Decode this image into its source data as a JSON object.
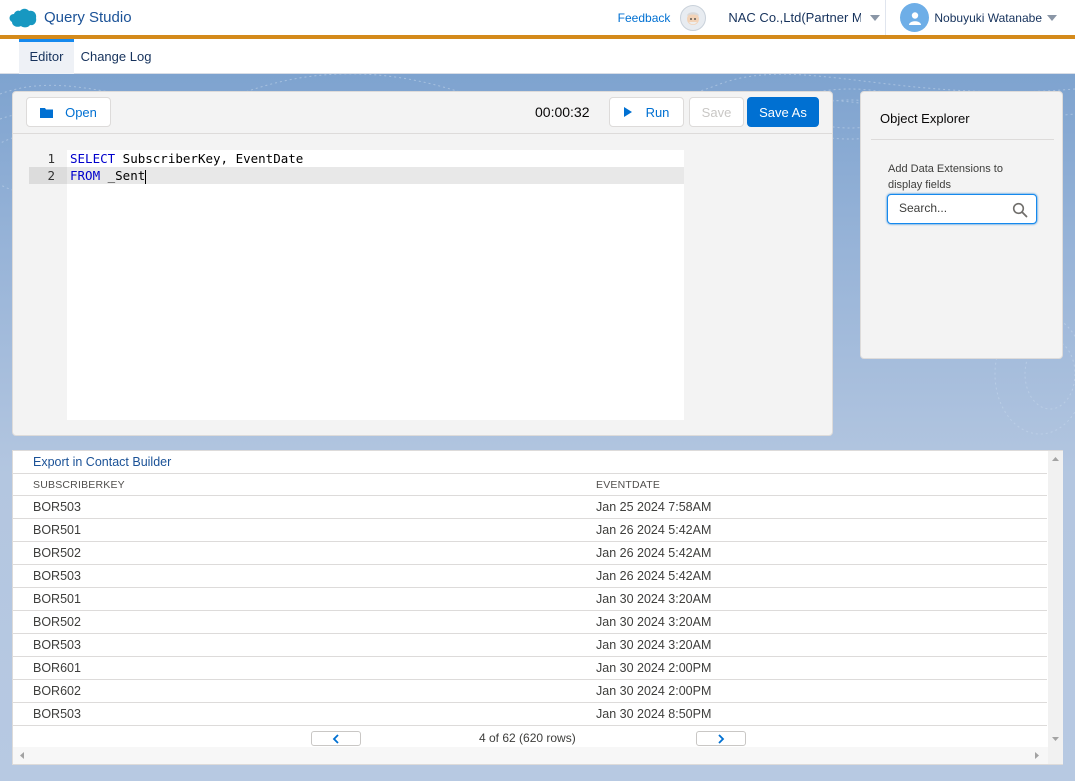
{
  "header": {
    "app_title": "Query Studio",
    "feedback_label": "Feedback",
    "account_name": "NAC Co.,Ltd(Partner M...",
    "user_name": "Nobuyuki Watanabe",
    "brand_color": "#1798c1",
    "accent_color": "#d48a1b"
  },
  "tabs": [
    {
      "label": "Editor",
      "active": true
    },
    {
      "label": "Change Log",
      "active": false
    }
  ],
  "editor": {
    "open_label": "Open",
    "timer": "00:00:32",
    "run_label": "Run",
    "save_label": "Save",
    "save_as_label": "Save As",
    "lines": [
      {
        "num": "1",
        "keyword": "SELECT",
        "rest": " SubscriberKey, EventDate"
      },
      {
        "num": "2",
        "keyword": "FROM",
        "rest": " _Sent"
      }
    ]
  },
  "explorer": {
    "title": "Object Explorer",
    "help_text": "Add Data Extensions to display fields",
    "search_placeholder": "Search..."
  },
  "results": {
    "export_label": "Export in Contact Builder",
    "columns": [
      "SUBSCRIBERKEY",
      "EVENTDATE"
    ],
    "rows": [
      [
        "BOR503",
        "Jan 25 2024 7:58AM"
      ],
      [
        "BOR501",
        "Jan 26 2024 5:42AM"
      ],
      [
        "BOR502",
        "Jan 26 2024 5:42AM"
      ],
      [
        "BOR503",
        "Jan 26 2024 5:42AM"
      ],
      [
        "BOR501",
        "Jan 30 2024 3:20AM"
      ],
      [
        "BOR502",
        "Jan 30 2024 3:20AM"
      ],
      [
        "BOR503",
        "Jan 30 2024 3:20AM"
      ],
      [
        "BOR601",
        "Jan 30 2024 2:00PM"
      ],
      [
        "BOR602",
        "Jan 30 2024 2:00PM"
      ],
      [
        "BOR503",
        "Jan 30 2024 8:50PM"
      ]
    ],
    "pager_text": "4 of 62 (620 rows)"
  }
}
